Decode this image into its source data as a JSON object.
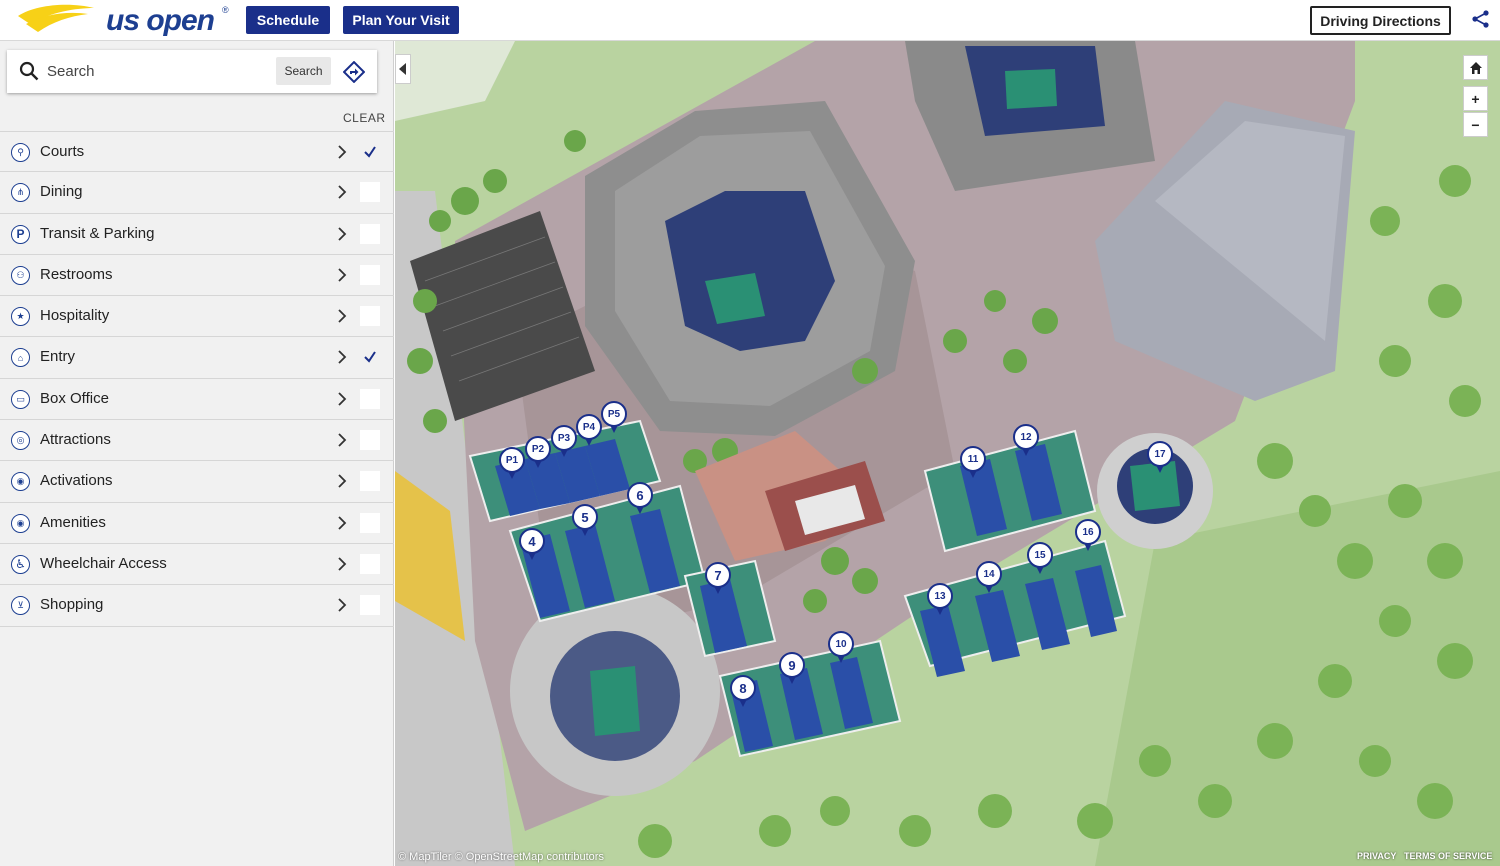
{
  "header": {
    "logo_text": "us open",
    "logo_reg": "®",
    "schedule_label": "Schedule",
    "plan_label": "Plan Your Visit",
    "driving_label": "Driving Directions",
    "share_icon": "share-icon",
    "brand_color": "#1a2f8a",
    "logo_yellow": "#f7d117"
  },
  "sidebar": {
    "search": {
      "placeholder": "Search",
      "button_label": "Search"
    },
    "clear_label": "CLEAR",
    "categories": [
      {
        "label": "Courts",
        "icon": "court-icon",
        "checked": true
      },
      {
        "label": "Dining",
        "icon": "dining-icon",
        "checked": false
      },
      {
        "label": "Transit & Parking",
        "icon": "parking-icon",
        "checked": false
      },
      {
        "label": "Restrooms",
        "icon": "restroom-icon",
        "checked": false
      },
      {
        "label": "Hospitality",
        "icon": "star-icon",
        "checked": false
      },
      {
        "label": "Entry",
        "icon": "entry-icon",
        "checked": true
      },
      {
        "label": "Box Office",
        "icon": "ticket-icon",
        "checked": false
      },
      {
        "label": "Attractions",
        "icon": "attraction-icon",
        "checked": false
      },
      {
        "label": "Activations",
        "icon": "activation-icon",
        "checked": false
      },
      {
        "label": "Amenities",
        "icon": "amenity-icon",
        "checked": false
      },
      {
        "label": "Wheelchair Access",
        "icon": "wheelchair-icon",
        "checked": false
      },
      {
        "label": "Shopping",
        "icon": "cart-icon",
        "checked": false
      }
    ]
  },
  "map": {
    "pins": [
      "P1",
      "P2",
      "P3",
      "P4",
      "P5",
      "4",
      "5",
      "6",
      "7",
      "8",
      "9",
      "10",
      "11",
      "12",
      "13",
      "14",
      "15",
      "16",
      "17"
    ],
    "attribution": "© MapTiler © OpenStreetMap contributors",
    "privacy": "PRIVACY",
    "terms": "TERMS OF SERVICE",
    "controls": {
      "zoom_in": "+",
      "zoom_out": "−"
    }
  }
}
